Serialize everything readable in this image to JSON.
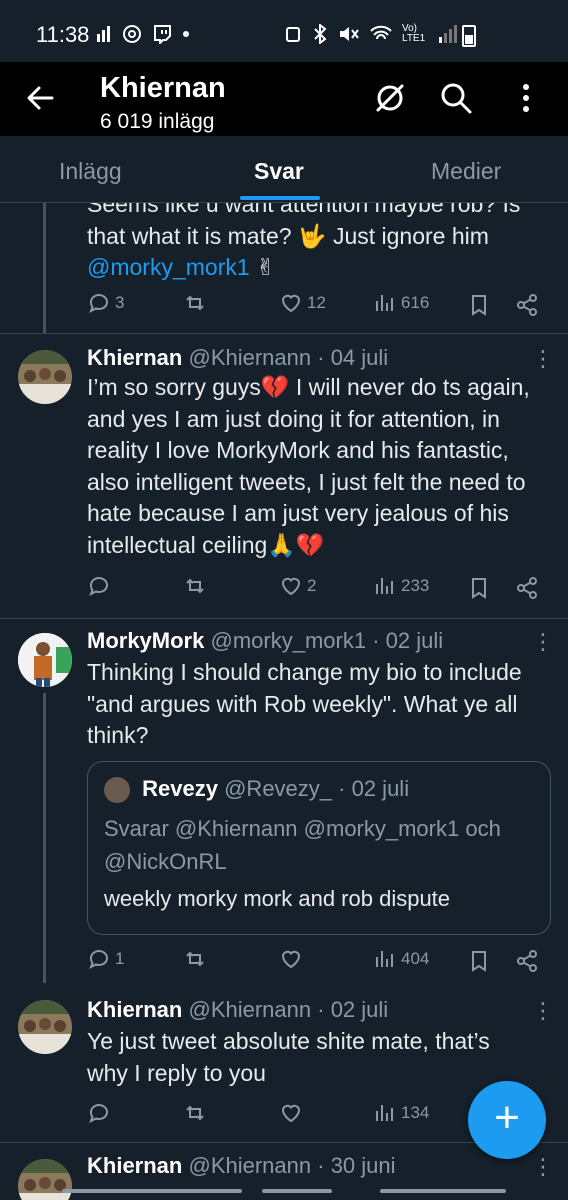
{
  "status_bar": {
    "time": "11:38",
    "network": "Vo) LTE1"
  },
  "header": {
    "title": "Khiernan",
    "subtitle": "6 019 inlägg"
  },
  "tabs": [
    {
      "label": "Inlägg",
      "active": false
    },
    {
      "label": "Svar",
      "active": true
    },
    {
      "label": "Medier",
      "active": false
    }
  ],
  "tweets": [
    {
      "text_clipped": "Seems like u want attention maybe rob? Is",
      "text_line2": "that what it is mate? 🤟 Just ignore him",
      "mention": "@morky_mork1",
      "emoji": "✌",
      "replies": "3",
      "retweets": "",
      "likes": "12",
      "views": "616"
    },
    {
      "name": "Khiernan",
      "handle": "@Khiernann",
      "date": "· 04 juli",
      "text": "I’m so sorry guys💔 I will never do ts again, and yes I am just doing it for attention, in reality I love MorkyMork and his fantastic, also intelligent tweets, I just felt the need to hate because I am just very jealous of his intellectual ceiling🙏💔",
      "replies": "",
      "retweets": "",
      "likes": "2",
      "views": "233"
    },
    {
      "name": "MorkyMork",
      "handle": "@morky_mork1",
      "date": "· 02 juli",
      "text": "Thinking I should change my bio to include \"and argues with Rob weekly\". What ye all think?",
      "quote": {
        "name": "Revezy",
        "handle": "@Revezy_",
        "date": "· 02 juli",
        "reply_to": "Svarar @Khiernann @morky_mork1 och @NickOnRL",
        "text": "weekly morky mork and rob dispute"
      },
      "replies": "1",
      "retweets": "",
      "likes": "",
      "views": "404"
    },
    {
      "name": "Khiernan",
      "handle": "@Khiernann",
      "date": "· 02 juli",
      "text": "Ye just tweet absolute shite mate, that’s why I reply to you",
      "replies": "",
      "retweets": "",
      "likes": "",
      "views": "134"
    },
    {
      "name": "Khiernan",
      "handle": "@Khiernann",
      "date": "· 30 juni"
    }
  ],
  "fab": {
    "label": "+"
  },
  "colors": {
    "background": "#15202b",
    "accent": "#1d9bf0",
    "muted": "#8b98a5",
    "header": "#000000"
  }
}
